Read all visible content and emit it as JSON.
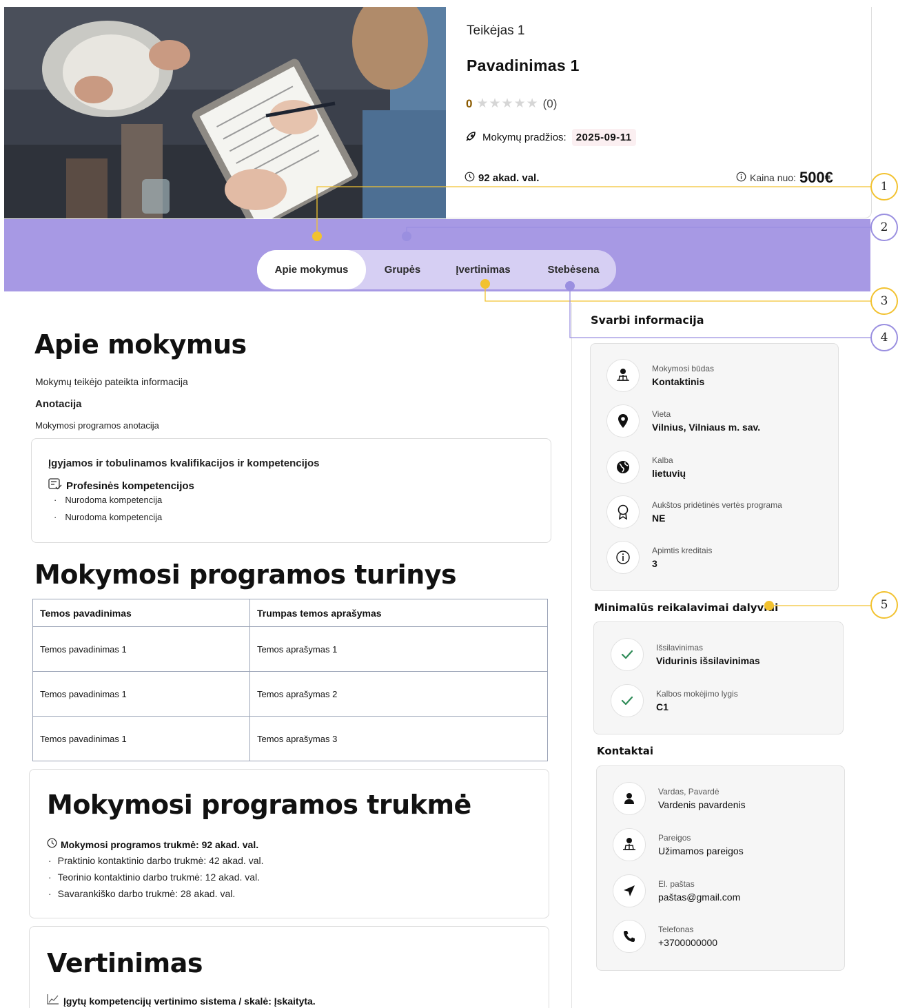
{
  "header": {
    "provider": "Teikėjas 1",
    "title": "Pavadinimas 1",
    "rating_value": "0",
    "stars": "★★★★★",
    "rating_count": "(0)",
    "start_label": "Mokymų pradžios:",
    "start_date": "2025-09-11",
    "hours": "92 akad. val.",
    "price_label": "Kaina nuo:",
    "price": "500€"
  },
  "tabs": [
    {
      "label": "Apie mokymus",
      "active": true
    },
    {
      "label": "Grupės",
      "active": false
    },
    {
      "label": "Įvertinimas",
      "active": false
    },
    {
      "label": "Stebėsena",
      "active": false
    }
  ],
  "about": {
    "heading": "Apie mokymus",
    "subtitle": "Mokymų teikėjo pateikta informacija",
    "annotation_title": "Anotacija",
    "annotation_text": "Mokymosi programos anotacija",
    "competencies_title": "Įgyjamos ir tobulinamos kvalifikacijos ir kompetencijos",
    "professional_title": "Profesinės kompetencijos",
    "competencies": [
      "Nurodoma kompetencija",
      "Nurodoma kompetencija"
    ]
  },
  "content": {
    "heading": "Mokymosi programos turinys",
    "columns": [
      "Temos pavadinimas",
      "Trumpas temos aprašymas"
    ],
    "rows": [
      [
        "Temos pavadinimas 1",
        "Temos aprašymas 1"
      ],
      [
        "Temos pavadinimas 1",
        "Temos aprašymas 2"
      ],
      [
        "Temos pavadinimas 1",
        "Temos aprašymas 3"
      ]
    ]
  },
  "duration": {
    "heading": "Mokymosi programos trukmė",
    "total": "Mokymosi programos trukmė: 92 akad. val.",
    "items": [
      "Praktinio kontaktinio darbo trukmė: 42 akad. val.",
      "Teorinio kontaktinio darbo trukmė: 12 akad. val.",
      "Savarankiško darbo trukmė: 28 akad. val."
    ]
  },
  "assessment": {
    "heading": "Vertinimas",
    "system": "Įgytų kompetencijų vertinimo sistema / skalė: Įskaityta."
  },
  "important": {
    "heading": "Svarbi informacija",
    "items": [
      {
        "label": "Mokymosi būdas",
        "value": "Kontaktinis",
        "icon": "person-desk-icon"
      },
      {
        "label": "Vieta",
        "value": "Vilnius, Vilniaus m. sav.",
        "icon": "location-pin-icon"
      },
      {
        "label": "Kalba",
        "value": "lietuvių",
        "icon": "globe-icon"
      },
      {
        "label": "Aukštos pridėtinės vertės programa",
        "value": "NE",
        "icon": "award-icon"
      },
      {
        "label": "Apimtis kreditais",
        "value": "3",
        "icon": "info-icon"
      }
    ]
  },
  "requirements": {
    "heading": "Minimalūs reikalavimai dalyviui",
    "items": [
      {
        "label": "Išsilavinimas",
        "value": "Vidurinis išsilavinimas",
        "icon": "check-icon"
      },
      {
        "label": "Kalbos mokėjimo lygis",
        "value": "C1",
        "icon": "check-icon"
      }
    ]
  },
  "contacts": {
    "heading": "Kontaktai",
    "items": [
      {
        "label": "Vardas, Pavardė",
        "value": "Vardenis pavardenis",
        "icon": "person-icon"
      },
      {
        "label": "Pareigos",
        "value": "Užimamos pareigos",
        "icon": "person-desk-icon"
      },
      {
        "label": "El. paštas",
        "value": "paštas@gmail.com",
        "icon": "send-icon"
      },
      {
        "label": "Telefonas",
        "value": "+3700000000",
        "icon": "phone-icon"
      }
    ]
  },
  "callouts": [
    "1",
    "2",
    "3",
    "4",
    "5"
  ],
  "colors": {
    "band": "#a799e4",
    "tabs_bg": "#d6cff3",
    "callout_yellow": "#f2c230",
    "callout_purple": "#9a8fe0",
    "check_green": "#2e8b57"
  }
}
